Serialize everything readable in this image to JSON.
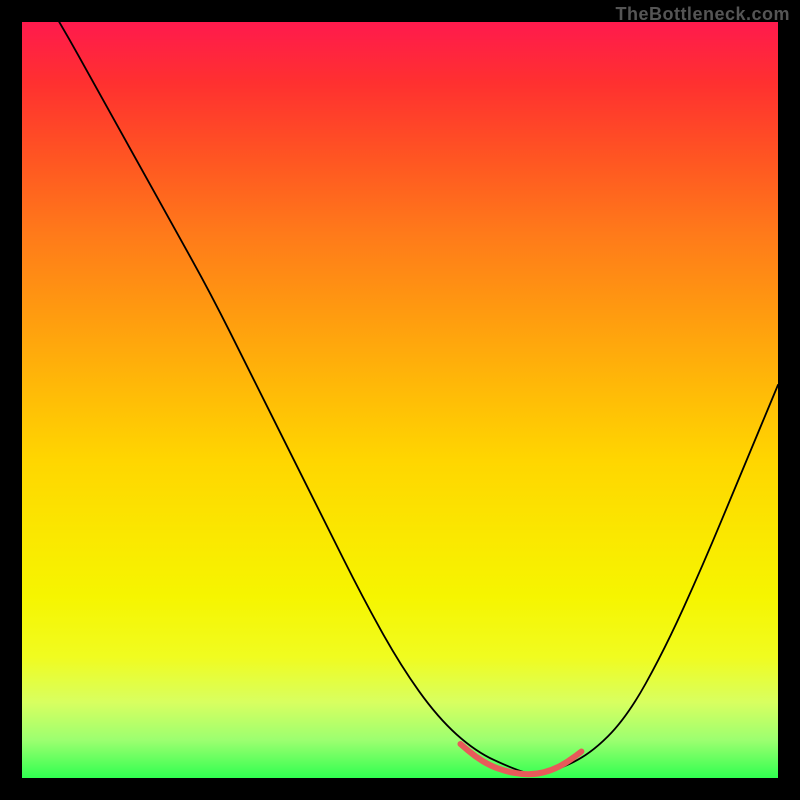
{
  "watermark": "TheBottleneck.com",
  "chart_data": {
    "type": "line",
    "title": "",
    "xlabel": "",
    "ylabel": "",
    "xlim": [
      0,
      100
    ],
    "ylim": [
      0,
      100
    ],
    "grid": false,
    "legend": false,
    "background_gradient": {
      "orientation": "vertical",
      "stops": [
        {
          "pos": 0,
          "color": "#ff1a4d"
        },
        {
          "pos": 50,
          "color": "#ffd600"
        },
        {
          "pos": 100,
          "color": "#30ff50"
        }
      ]
    },
    "series": [
      {
        "name": "bottleneck-curve",
        "color": "#000000",
        "x": [
          0,
          5,
          10,
          15,
          20,
          25,
          30,
          35,
          40,
          45,
          50,
          55,
          60,
          65,
          68,
          70,
          75,
          80,
          85,
          90,
          95,
          100
        ],
        "y": [
          108,
          100,
          91,
          82,
          73,
          64,
          54,
          44,
          34,
          24,
          15,
          8,
          3.5,
          1.2,
          0.3,
          0.8,
          3,
          8,
          17,
          28,
          40,
          52
        ]
      },
      {
        "name": "optimal-zone-marker",
        "color": "#e85a5a",
        "stroke_width": 6,
        "x": [
          58,
          60,
          62,
          64,
          66,
          68,
          70,
          72,
          74
        ],
        "y": [
          4.5,
          2.8,
          1.6,
          0.9,
          0.5,
          0.5,
          1.0,
          2.0,
          3.5
        ]
      }
    ],
    "annotations": []
  }
}
